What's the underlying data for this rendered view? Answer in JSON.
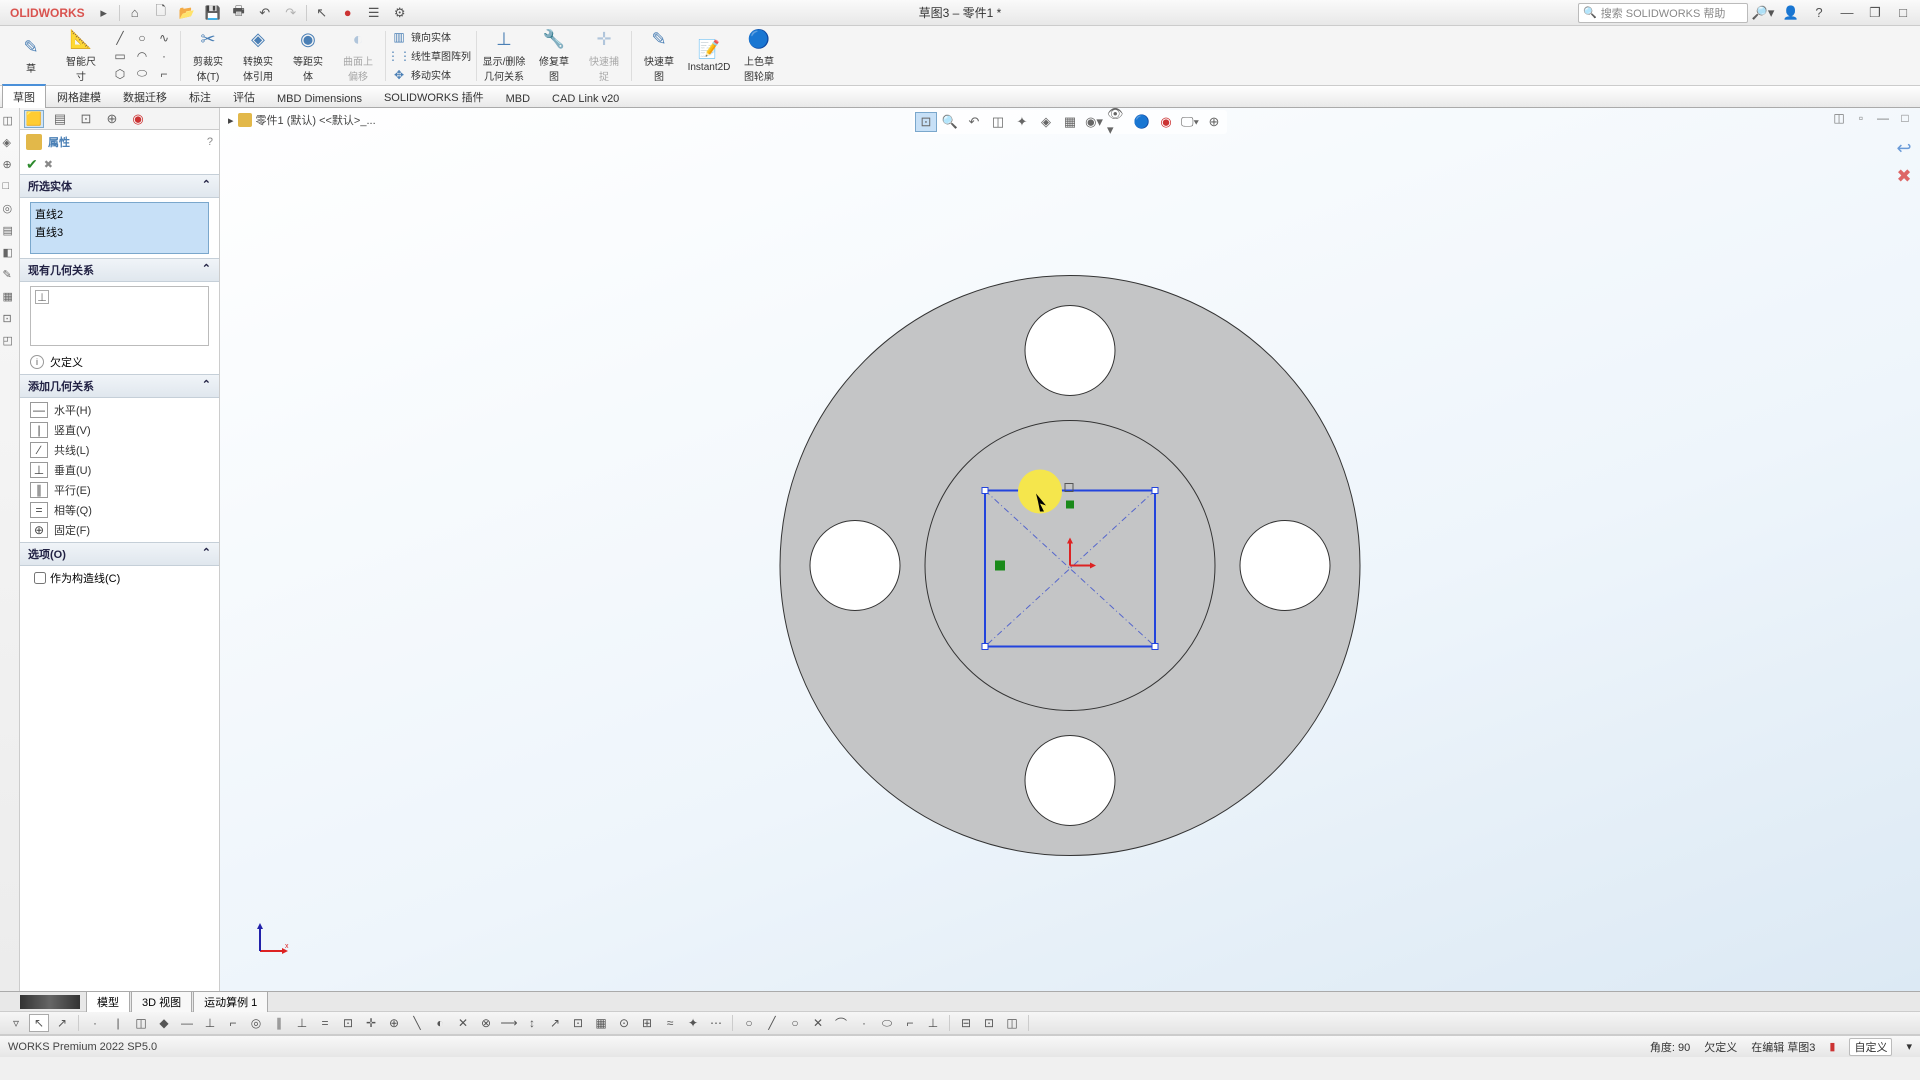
{
  "app": {
    "name": "OLIDWORKS",
    "doc_title": "草图3 – 零件1 *"
  },
  "search": {
    "placeholder": "搜索 SOLIDWORKS 帮助"
  },
  "ribbon": {
    "smart_dimension": "智能尺\n寸",
    "trim": "剪裁实\n体(T)",
    "convert": "转换实\n体引用",
    "offset": "等距实\n体",
    "surface": "曲面上\n偏移",
    "mirror": "镜向实体",
    "linear_pattern": "线性草图阵列",
    "move": "移动实体",
    "display_delete": "显示/删除\n几何关系",
    "repair": "修复草\n图",
    "quick_snap": "快速捕\n捉",
    "rapid_sketch": "快速草\n图",
    "instant2d": "Instant2D",
    "shaded": "上色草\n图轮廓"
  },
  "tabs": [
    {
      "label": "草图",
      "active": true
    },
    {
      "label": "网格建模",
      "active": false
    },
    {
      "label": "数据迁移",
      "active": false
    },
    {
      "label": "标注",
      "active": false
    },
    {
      "label": "评估",
      "active": false
    },
    {
      "label": "MBD Dimensions",
      "active": false
    },
    {
      "label": "SOLIDWORKS 插件",
      "active": false
    },
    {
      "label": "MBD",
      "active": false
    },
    {
      "label": "CAD Link v20",
      "active": false
    }
  ],
  "breadcrumb": "零件1 (默认) <<默认>_...",
  "panel": {
    "title": "属性",
    "sections": {
      "selected_entities": "所选实体",
      "selected_items": [
        "直线2",
        "直线3"
      ],
      "existing_relations": "现有几何关系",
      "under_defined": "欠定义",
      "add_relations": "添加几何关系",
      "relations": [
        {
          "icon": "—",
          "label": "水平(H)"
        },
        {
          "icon": "|",
          "label": "竖直(V)"
        },
        {
          "icon": "∕",
          "label": "共线(L)"
        },
        {
          "icon": "⊥",
          "label": "垂直(U)"
        },
        {
          "icon": "∥",
          "label": "平行(E)"
        },
        {
          "icon": "=",
          "label": "相等(Q)"
        },
        {
          "icon": "⊕",
          "label": "固定(F)"
        }
      ],
      "options": "选项(O)",
      "construction": "作为构造线(C)"
    }
  },
  "bottom_tabs": [
    "模型",
    "3D 视图",
    "运动算例 1"
  ],
  "status": {
    "premium": "WORKS Premium 2022 SP5.0",
    "angle": "角度: 90",
    "under": "欠定义",
    "editing": "在编辑 草图3",
    "mmgs": "自定义"
  }
}
